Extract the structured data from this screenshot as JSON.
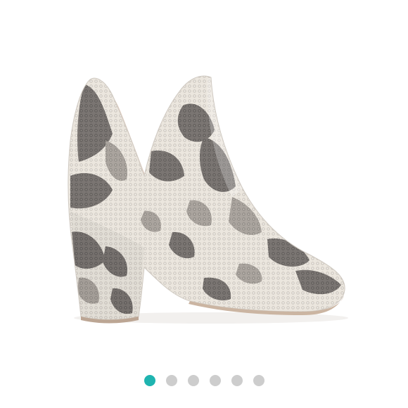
{
  "product_image": {
    "subject": "snakeskin-ankle-bootie-icon",
    "colors": {
      "base": "#e9e4dc",
      "light": "#f3efe8",
      "pattern_dark": "#6e6a68",
      "pattern_mid": "#9b9691",
      "lining": "#efe2d9",
      "sole": "#cbb5a2",
      "heel_shadow": "#c9c3bb"
    }
  },
  "carousel": {
    "total_slides": 6,
    "active_index": 0,
    "colors": {
      "active": "#1fb4b0",
      "inactive": "#cdcdcd"
    }
  }
}
